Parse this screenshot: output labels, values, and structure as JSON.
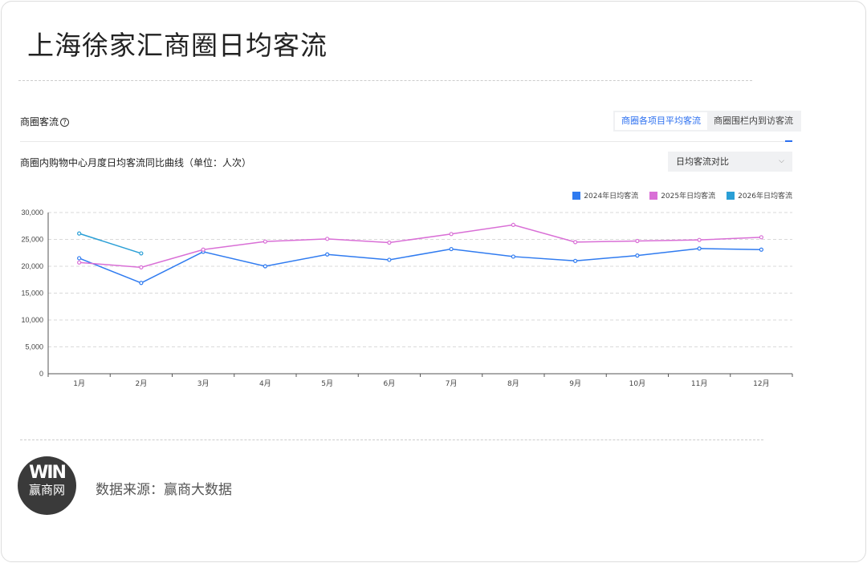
{
  "title": "上海徐家汇商圈日均客流",
  "section": {
    "title": "商圈客流",
    "help_icon": "?"
  },
  "tabs": [
    {
      "label": "商圈各项目平均客流",
      "active": true
    },
    {
      "label": "商圈围栏内到访客流",
      "active": false
    }
  ],
  "select": {
    "value": "日均客流对比"
  },
  "chart_data": {
    "type": "line",
    "title": "商圈内购物中心月度日均客流同比曲线（单位：人次）",
    "categories": [
      "1月",
      "2月",
      "3月",
      "4月",
      "5月",
      "6月",
      "7月",
      "8月",
      "9月",
      "10月",
      "11月",
      "12月"
    ],
    "ylim": [
      0,
      30000
    ],
    "yticks": [
      "0",
      "5,000",
      "10,000",
      "15,000",
      "20,000",
      "25,000",
      "30,000"
    ],
    "ytick_values": [
      0,
      5000,
      10000,
      15000,
      20000,
      25000,
      30000
    ],
    "grid": true,
    "legend_position": "top-right",
    "series": [
      {
        "name": "2024年日均客流",
        "color": "#2f7bf0",
        "values": [
          21500,
          16900,
          22700,
          20000,
          22200,
          21200,
          23200,
          21800,
          21000,
          22000,
          23300,
          23100
        ]
      },
      {
        "name": "2025年日均客流",
        "color": "#d96fd6",
        "values": [
          20700,
          19800,
          23100,
          24600,
          25100,
          24400,
          26000,
          27700,
          24500,
          24700,
          24900,
          25400
        ]
      },
      {
        "name": "2026年日均客流",
        "color": "#2a9fd6",
        "values": [
          26100,
          22400
        ]
      }
    ]
  },
  "footer": {
    "logo_text": "WIN",
    "logo_sub": "赢商网",
    "source": "数据来源：赢商大数据"
  }
}
